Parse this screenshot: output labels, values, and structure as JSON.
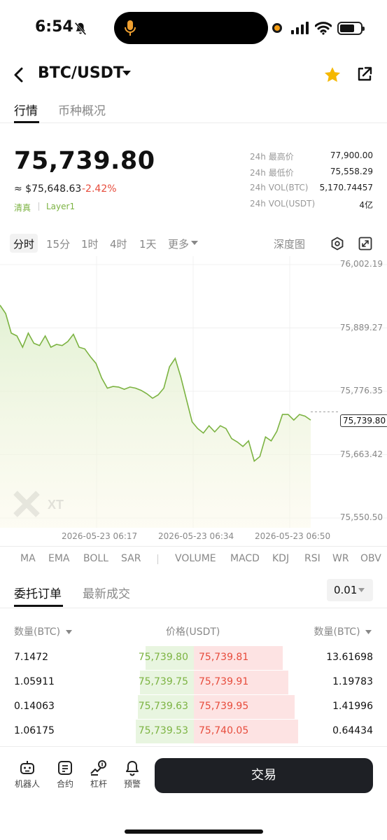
{
  "status": {
    "time": "6:54"
  },
  "header": {
    "pair": "BTC/USDT"
  },
  "tabs": [
    {
      "label": "行情"
    },
    {
      "label": "币种概况"
    }
  ],
  "ticker": {
    "price": "75,739.80",
    "approx": "≈ $75,648.63",
    "change": "-2.42%",
    "tags": [
      "清真",
      "Layer1"
    ],
    "stats": [
      {
        "label": "24h 最高价",
        "value": "77,900.00"
      },
      {
        "label": "24h 最低价",
        "value": "75,558.29"
      },
      {
        "label": "24h VOL(BTC)",
        "value": "5,170.74457"
      },
      {
        "label": "24h VOL(USDT)",
        "value": "4亿"
      }
    ]
  },
  "timeframes": [
    "分时",
    "15分",
    "1时",
    "4时",
    "1天",
    "更多"
  ],
  "depth_label": "深度图",
  "chart_data": {
    "type": "area",
    "x_ticks": [
      "2026-05-23 06:17",
      "2026-05-23 06:34",
      "2026-05-23 06:50"
    ],
    "y_ticks": [
      "76,002.19",
      "75,889.27",
      "75,776.35",
      "75,663.42",
      "75,550.50"
    ],
    "ylim": [
      75550.5,
      76002.19
    ],
    "current_price_label": "75,739.80",
    "current_price": 75739.8,
    "series": [
      {
        "values": [
          75930,
          75915,
          75880,
          75875,
          75855,
          75880,
          75862,
          75858,
          75875,
          75855,
          75860,
          75858,
          75865,
          75878,
          75855,
          75852,
          75838,
          75826,
          75800,
          75782,
          75785,
          75784,
          75780,
          75784,
          75782,
          75778,
          75772,
          75764,
          75770,
          75782,
          75820,
          75835,
          75802,
          75762,
          75722,
          75710,
          75702,
          75715,
          75704,
          75715,
          75710,
          75692,
          75686,
          75678,
          75688,
          75652,
          75660,
          75695,
          75688,
          75705,
          75735,
          75735,
          75725,
          75735,
          75732,
          75725
        ]
      }
    ],
    "watermark": "XT"
  },
  "indicators": {
    "main": [
      "MA",
      "EMA",
      "BOLL",
      "SAR"
    ],
    "sub": [
      "VOLUME",
      "MACD",
      "KDJ",
      "RSI",
      "WR",
      "OBV"
    ]
  },
  "order_tabs": [
    "委托订单",
    "最新成交"
  ],
  "precision": "0.01",
  "orderbook": {
    "headers": {
      "left": "数量(BTC)",
      "center": "价格(USDT)",
      "right": "数量(BTC)"
    },
    "rows": [
      {
        "bid_qty": "7.1472",
        "bid": "75,739.80",
        "ask": "75,739.81",
        "ask_qty": "13.61698",
        "bid_depth": 0.25,
        "ask_depth": 0.46
      },
      {
        "bid_qty": "1.05911",
        "bid": "75,739.75",
        "ask": "75,739.91",
        "ask_qty": "1.19783",
        "bid_depth": 0.28,
        "ask_depth": 0.49
      },
      {
        "bid_qty": "0.14063",
        "bid": "75,739.63",
        "ask": "75,739.95",
        "ask_qty": "1.41996",
        "bid_depth": 0.29,
        "ask_depth": 0.52
      },
      {
        "bid_qty": "1.06175",
        "bid": "75,739.53",
        "ask": "75,740.05",
        "ask_qty": "0.64434",
        "bid_depth": 0.3,
        "ask_depth": 0.54
      }
    ]
  },
  "bottom_nav": [
    {
      "label": "机器人"
    },
    {
      "label": "合约"
    },
    {
      "label": "杠杆"
    },
    {
      "label": "预警"
    }
  ],
  "trade_button": "交易",
  "colors": {
    "up": "#7cb342",
    "down": "#e74c3c",
    "star": "#f5b800",
    "dark": "#1e2025"
  }
}
